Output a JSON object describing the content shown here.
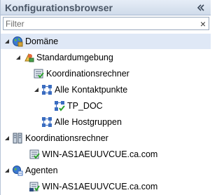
{
  "panel": {
    "title": "Konfigurationsbrowser",
    "collapse_icon": "double-chevron-left-icon"
  },
  "filter": {
    "placeholder": "Filter",
    "value": "",
    "clear_label": "×"
  },
  "tree": {
    "domain": "Domäne",
    "standard_env": "Standardumgebung",
    "coord_computer": "Koordinationsrechner",
    "all_contact_points": "Alle Kontaktpunkte",
    "tp_doc": "TP_DOC",
    "all_host_groups": "Alle Hostgruppen",
    "coord_computers_group": "Koordinationsrechner",
    "coord_host": "WIN-AS1AEUUVCUE.ca.com",
    "agents": "Agenten",
    "agent_host": "WIN-AS1AEUUVCUE.ca.com"
  },
  "colors": {
    "accent": "#3a6cc0",
    "header_bg": "#d9e3f0",
    "selected_bg": "#dfe8f6"
  }
}
